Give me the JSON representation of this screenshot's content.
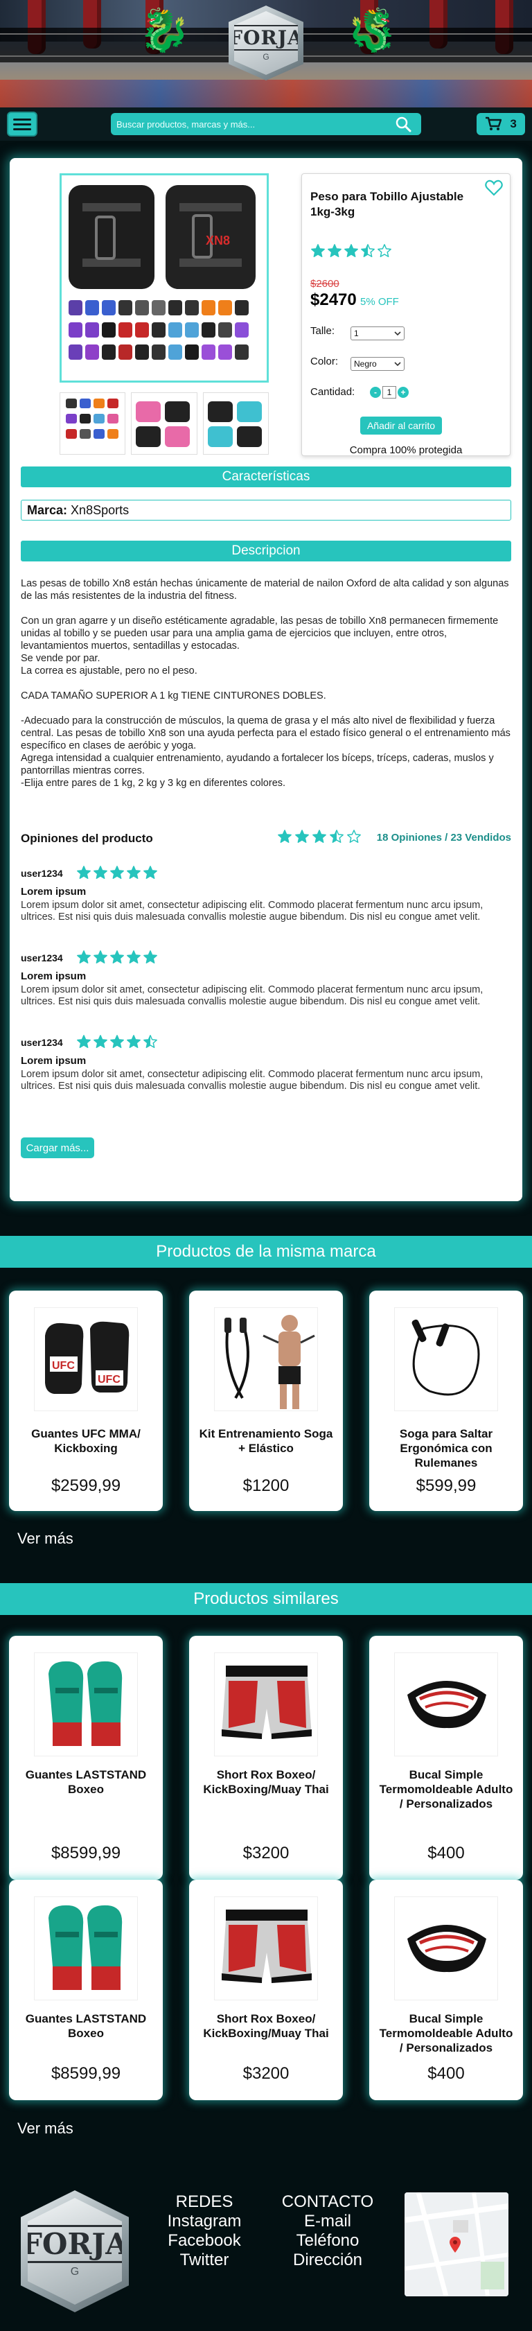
{
  "header": {
    "logo_text": "FORJA",
    "search_placeholder": "Buscar productos, marcas y más...",
    "cart_count": "3"
  },
  "product": {
    "title": "Peso para Tobillo Ajustable 1kg-3kg",
    "rating": 3.5,
    "old_price": "$2600",
    "price": "$2470",
    "discount": "5% OFF",
    "size_label": "Talle:",
    "size_value": "1",
    "color_label": "Color:",
    "color_value": "Negro",
    "qty_label": "Cantidad:",
    "qty_value": "1",
    "qty_minus": "-",
    "qty_plus": "+",
    "add_to_cart": "Añadir al carrito",
    "guarantee": "Compra 100% protegida",
    "image_brand": "XN8"
  },
  "features": {
    "heading": "Características",
    "brand_label": "Marca:",
    "brand_value": "Xn8Sports"
  },
  "description": {
    "heading": "Descripcion",
    "paragraphs": [
      "Las pesas de tobillo Xn8 están hechas únicamente de material de nailon Oxford de alta calidad y son algunas de las más resistentes de la industria del fitness.",
      "",
      "Con un gran agarre y un diseño estéticamente agradable, las pesas de tobillo Xn8 permanecen firmemente unidas al tobillo y se pueden usar para una amplia gama de ejercicios que incluyen, entre otros, levantamientos muertos, sentadillas y estocadas.",
      "Se vende por par.",
      "La correa es ajustable, pero no el peso.",
      "",
      "CADA TAMAÑO SUPERIOR A 1 kg TIENE CINTURONES DOBLES.",
      "",
      "-Adecuado para la construcción de músculos, la quema de grasa y el más alto nivel de flexibilidad y fuerza central. Las pesas de tobillo Xn8 son una ayuda perfecta para el estado físico general o el entrenamiento más específico en clases de aeróbic y yoga.",
      "Agrega intensidad a cualquier entrenamiento, ayudando a fortalecer los bíceps, tríceps, caderas, muslos y pantorrillas mientras corres.",
      "-Elija entre pares de 1 kg, 2 kg y 3 kg en diferentes colores."
    ]
  },
  "reviews": {
    "heading": "Opiniones del producto",
    "average": 3.5,
    "summary": "18 Opiniones / 23 Vendidos",
    "items": [
      {
        "user": "user1234",
        "rating": 5,
        "title": "Lorem ipsum",
        "body": "Lorem ipsum dolor sit amet, consectetur adipiscing elit. Commodo placerat fermentum nunc arcu ipsum, ultrices. Est nisi quis duis malesuada convallis molestie augue bibendum. Dis nisl eu congue amet velit."
      },
      {
        "user": "user1234",
        "rating": 5,
        "title": "Lorem ipsum",
        "body": "Lorem ipsum dolor sit amet, consectetur adipiscing elit. Commodo placerat fermentum nunc arcu ipsum, ultrices. Est nisi quis duis malesuada convallis molestie augue bibendum. Dis nisl eu congue amet velit."
      },
      {
        "user": "user1234",
        "rating": 4.5,
        "title": "Lorem ipsum",
        "body": "Lorem ipsum dolor sit amet, consectetur adipiscing elit. Commodo placerat fermentum nunc arcu ipsum, ultrices. Est nisi quis duis malesuada convallis molestie augue bibendum. Dis nisl eu congue amet velit."
      }
    ],
    "load_more": "Cargar más..."
  },
  "same_brand": {
    "heading": "Productos de la misma marca",
    "items": [
      {
        "name": "Guantes UFC MMA/ Kickboxing",
        "price": "$2599,99"
      },
      {
        "name": "Kit Entrenamiento Soga + Elástico",
        "price": "$1200"
      },
      {
        "name": "Soga para Saltar Ergonómica con Rulemanes",
        "price": "$599,99"
      }
    ],
    "more": "Ver más"
  },
  "similar": {
    "heading": "Productos similares",
    "items": [
      {
        "name": "Guantes LASTSTAND Boxeo",
        "price": "$8599,99"
      },
      {
        "name": "Short Rox Boxeo/ KickBoxing/Muay Thai",
        "price": "$3200"
      },
      {
        "name": "Bucal Simple Termomoldeable Adulto / Personalizados",
        "price": "$400"
      },
      {
        "name": "Guantes LASTSTAND Boxeo",
        "price": "$8599,99"
      },
      {
        "name": "Short Rox Boxeo/ KickBoxing/Muay Thai",
        "price": "$3200"
      },
      {
        "name": "Bucal Simple Termomoldeable Adulto / Personalizados",
        "price": "$400"
      }
    ],
    "more": "Ver más"
  },
  "footer": {
    "logo_text": "FORJA",
    "social_heading": "REDES",
    "social_links": [
      "Instagram",
      "Facebook",
      "Twitter"
    ],
    "contact_heading": "CONTACTO",
    "contact_links": [
      "E-mail",
      "Teléfono",
      "Dirección"
    ]
  },
  "colors": {
    "accent": "#27c4bd",
    "background": "#031012",
    "price_old": "#d94444"
  }
}
